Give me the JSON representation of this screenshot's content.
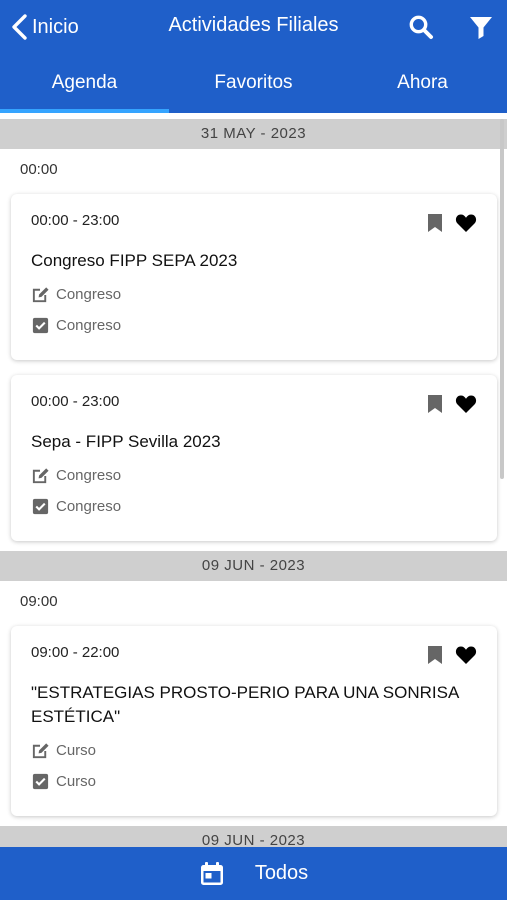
{
  "header": {
    "back_label": "Inicio",
    "title": "Actividades Filiales",
    "search_icon": "search-icon",
    "filter_icon": "filter-icon",
    "color": "#1f5fc9"
  },
  "tabs": [
    {
      "label": "Agenda",
      "active": true
    },
    {
      "label": "Favoritos",
      "active": false
    },
    {
      "label": "Ahora",
      "active": false
    }
  ],
  "accent_color": "#35a4ff",
  "days": [
    {
      "date": "31 MAY - 2023",
      "time": "00:00",
      "events": [
        {
          "time": "00:00 - 23:00",
          "title": "Congreso FIPP SEPA 2023",
          "type": "Congreso",
          "category": "Congreso"
        },
        {
          "time": "00:00 - 23:00",
          "title": "Sepa - FIPP Sevilla 2023",
          "type": "Congreso",
          "category": "Congreso"
        }
      ]
    },
    {
      "date": "09 JUN - 2023",
      "time": "09:00",
      "events": [
        {
          "time": "09:00 - 22:00",
          "title": "\"ESTRATEGIAS PROSTO-PERIO PARA UNA SONRISA ESTÉTICA\"",
          "type": "Curso",
          "category": "Curso"
        }
      ]
    },
    {
      "date": "09 JUN - 2023"
    }
  ],
  "bottom": {
    "label": "Todos",
    "icon": "calendar-icon"
  }
}
